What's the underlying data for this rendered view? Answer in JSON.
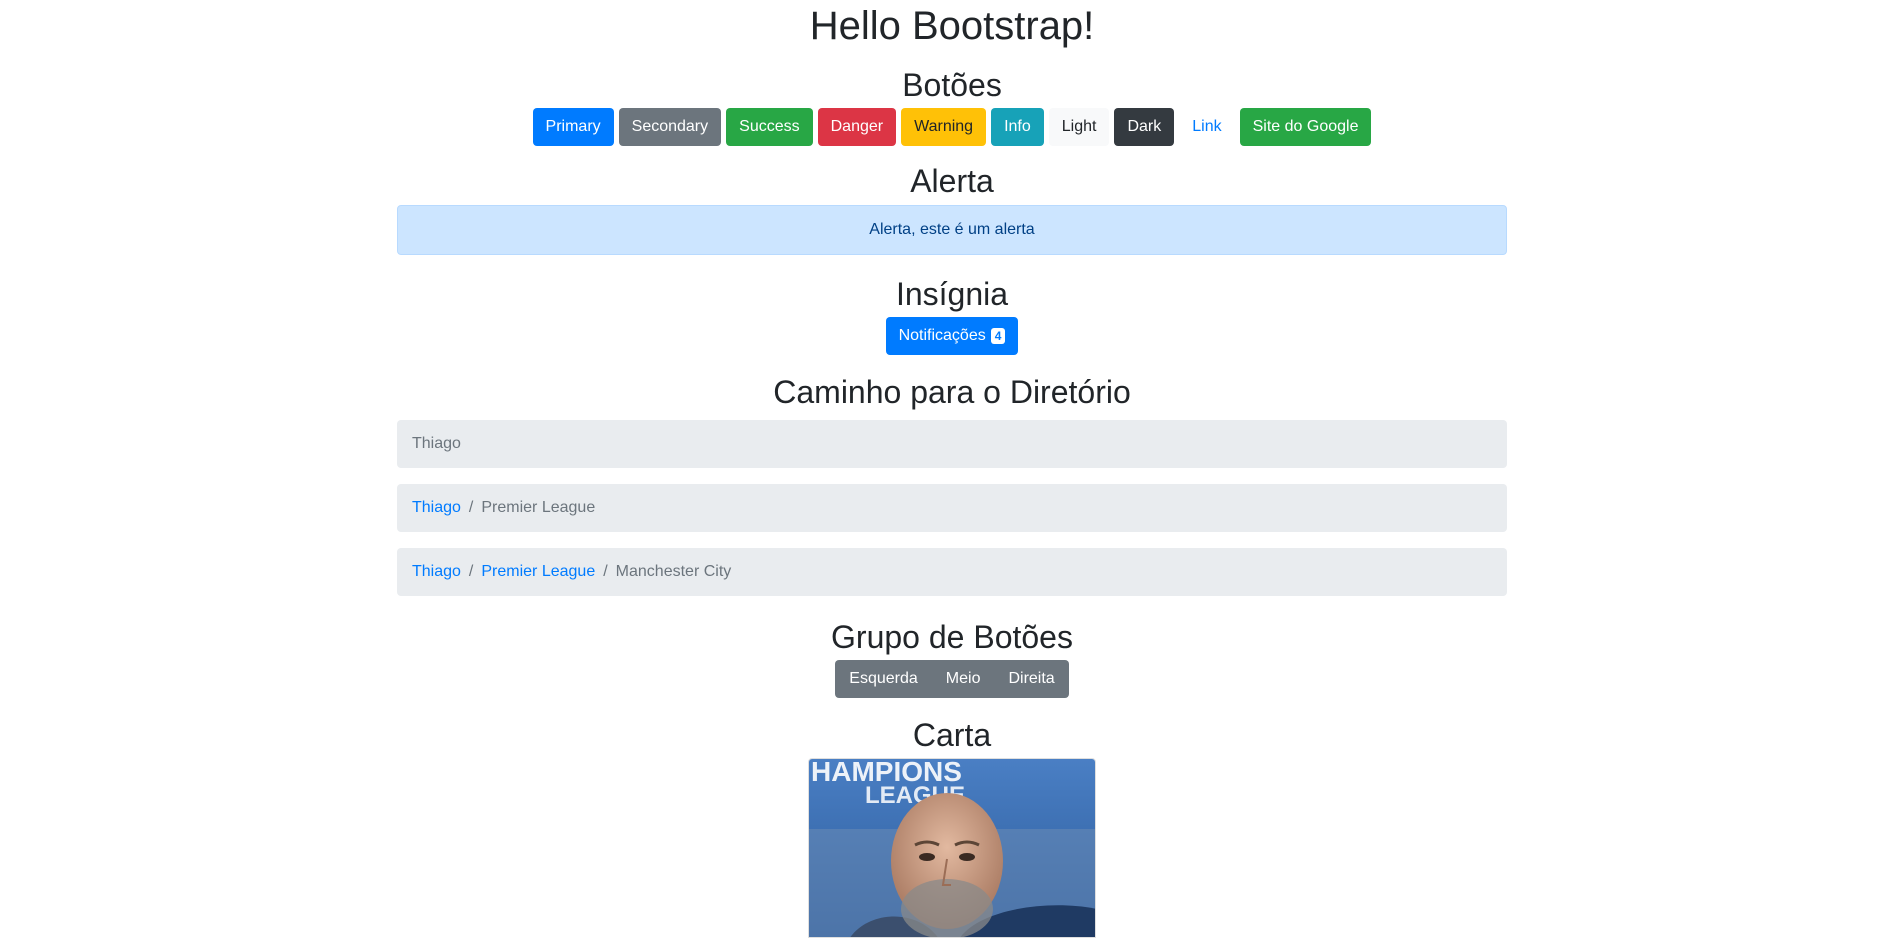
{
  "title": "Hello Bootstrap!",
  "buttons_section": {
    "title": "Botões",
    "buttons": [
      "Primary",
      "Secondary",
      "Success",
      "Danger",
      "Warning",
      "Info",
      "Light",
      "Dark",
      "Link"
    ],
    "google_button": "Site do Google"
  },
  "alert_section": {
    "title": "Alerta",
    "text": "Alerta, este é um alerta"
  },
  "badge_section": {
    "title": "Insígnia",
    "button_label": "Notificações",
    "badge_count": "4"
  },
  "breadcrumb_section": {
    "title": "Caminho para o Diretório",
    "crumbs": [
      {
        "items": [
          "Thiago"
        ]
      },
      {
        "items": [
          "Thiago",
          "Premier League"
        ]
      },
      {
        "items": [
          "Thiago",
          "Premier League",
          "Manchester City"
        ]
      }
    ],
    "separator": "/"
  },
  "group_section": {
    "title": "Grupo de Botões",
    "buttons": [
      "Esquerda",
      "Meio",
      "Direita"
    ]
  },
  "card_section": {
    "title": "Carta",
    "image_banner_text": "HAMPIONS\nLEAGUE"
  }
}
